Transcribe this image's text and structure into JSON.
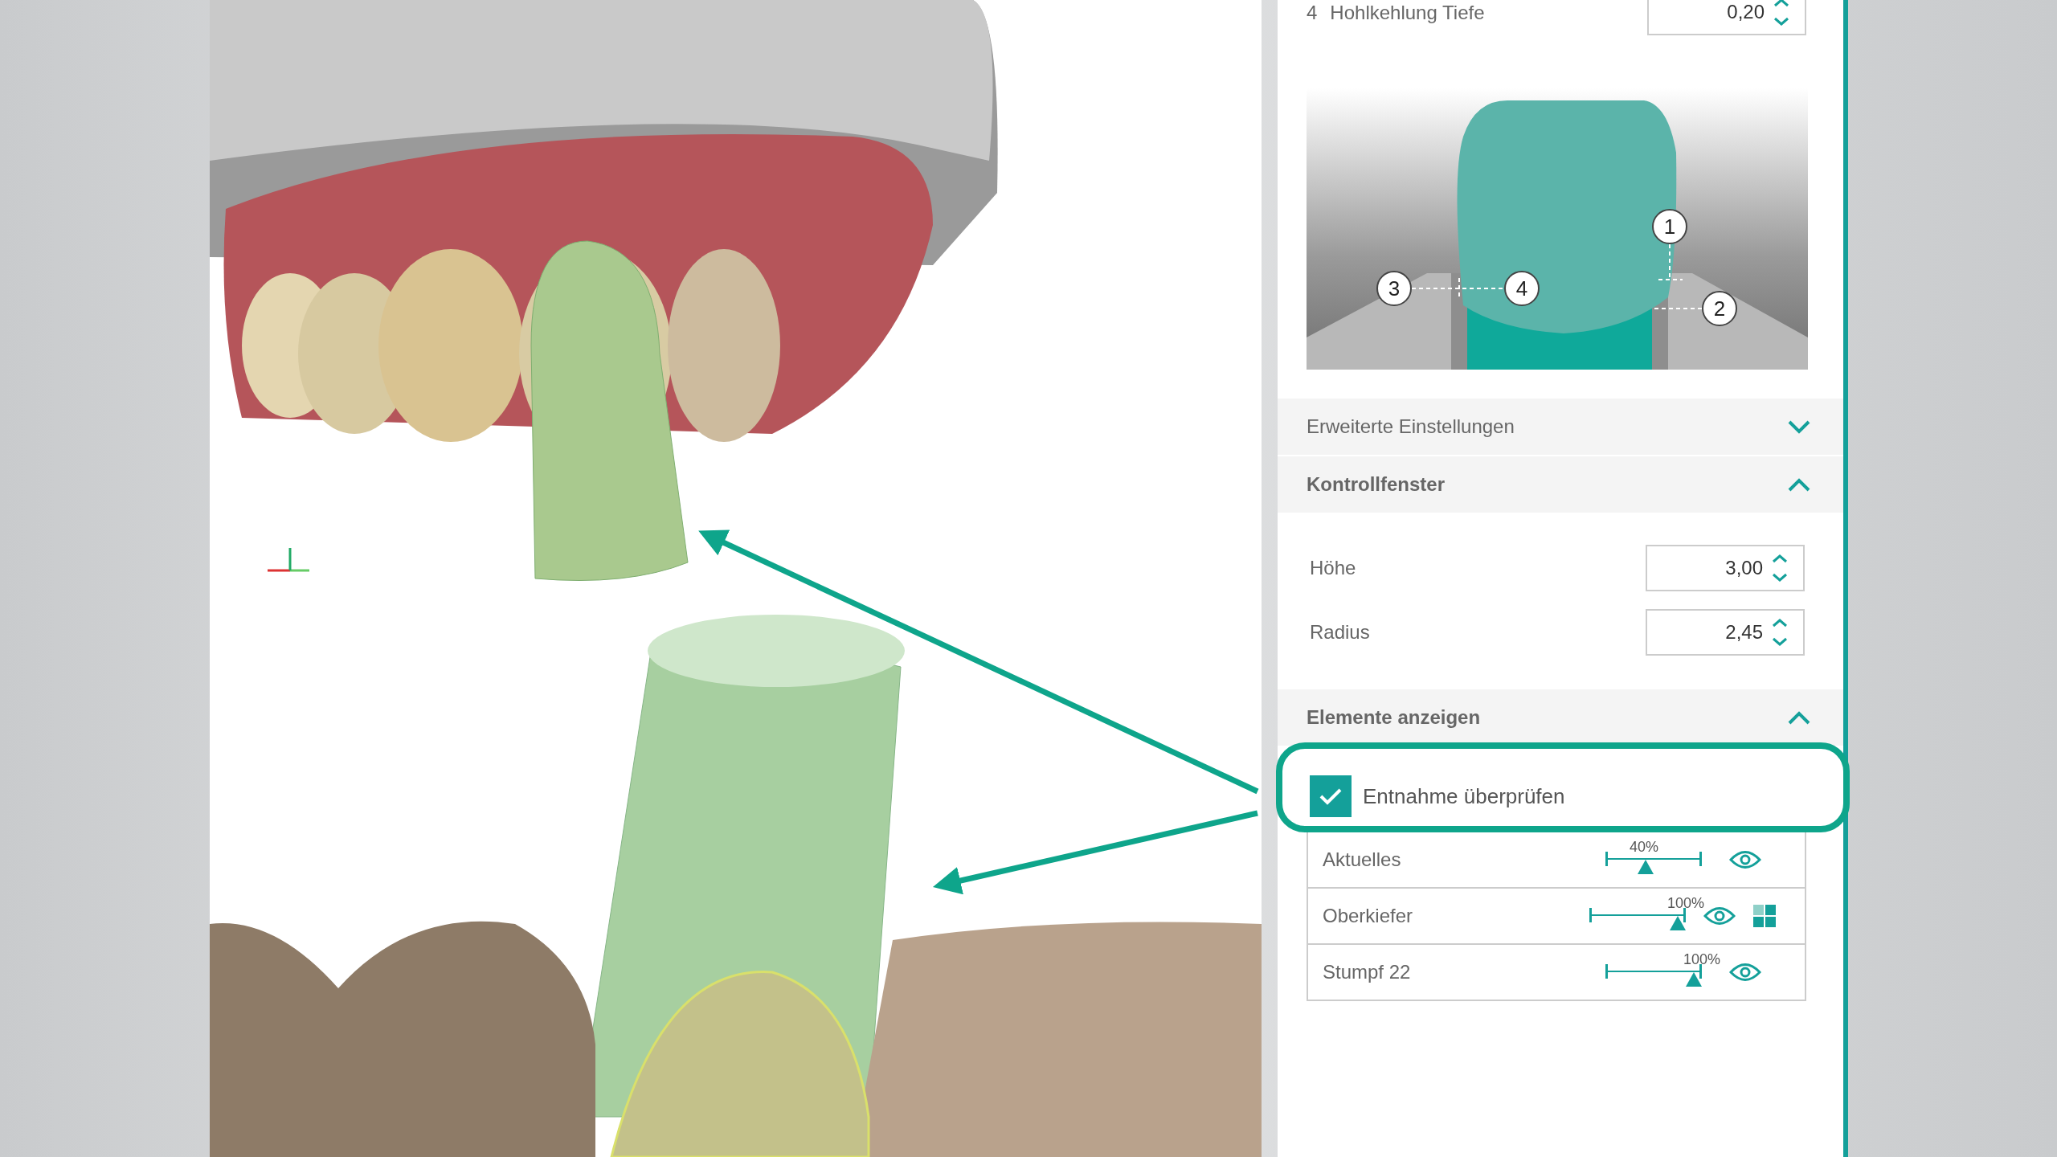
{
  "parameters": {
    "top_row": {
      "number": "4",
      "label": "Hohlkehlung Tiefe",
      "value": "0,20"
    },
    "diagram": {
      "callouts": [
        "1",
        "3",
        "4",
        "2"
      ]
    }
  },
  "sections": [
    {
      "title": "Erweiterte Einstellungen",
      "expanded": false
    },
    {
      "title": "Kontrollfenster",
      "expanded": true,
      "fields": [
        {
          "label": "Höhe",
          "value": "3,00"
        },
        {
          "label": "Radius",
          "value": "2,45"
        }
      ]
    },
    {
      "title": "Elemente anzeigen",
      "expanded": true
    }
  ],
  "removal_check": {
    "label": "Entnahme überprüfen",
    "checked": true,
    "highlighted": true
  },
  "elements": [
    {
      "name": "Aktuelles",
      "opacity": "40%",
      "level": 0.4,
      "visible": true,
      "texture_toggle": false
    },
    {
      "name": "Oberkiefer",
      "opacity": "100%",
      "level": 1,
      "visible": true,
      "texture_toggle": true
    },
    {
      "name": "Stumpf 22",
      "opacity": "100%",
      "level": 1,
      "visible": true,
      "texture_toggle": false
    }
  ]
}
